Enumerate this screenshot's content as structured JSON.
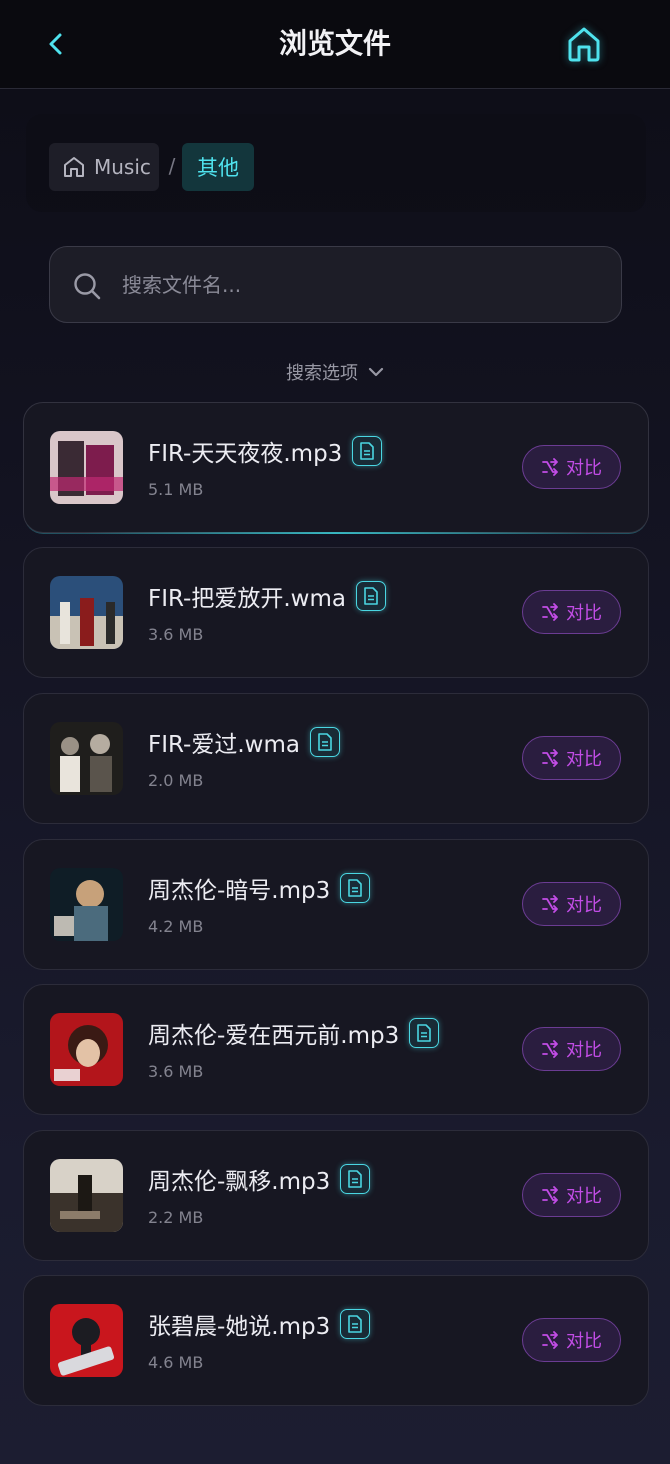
{
  "header": {
    "title": "浏览文件"
  },
  "breadcrumb": {
    "root": "Music",
    "separator": "/",
    "current": "其他"
  },
  "search": {
    "placeholder": "搜索文件名...",
    "value": ""
  },
  "search_options_label": "搜索选项",
  "compare_label": "对比",
  "files": [
    {
      "name": "FIR-天天夜夜.mp3",
      "size": "5.1 MB",
      "cover_colors": [
        "#d9c6c9",
        "#7d1c4d",
        "#3a2a34"
      ]
    },
    {
      "name": "FIR-把爱放开.wma",
      "size": "3.6 MB",
      "cover_colors": [
        "#2b4f7a",
        "#c9c2b5",
        "#8a1c1c"
      ]
    },
    {
      "name": "FIR-爱过.wma",
      "size": "2.0 MB",
      "cover_colors": [
        "#1f1e1c",
        "#9a9186",
        "#e9e4dc"
      ]
    },
    {
      "name": "周杰伦-暗号.mp3",
      "size": "4.2 MB",
      "cover_colors": [
        "#0f1d26",
        "#c7a17a",
        "#4b6b7d"
      ]
    },
    {
      "name": "周杰伦-爱在西元前.mp3",
      "size": "3.6 MB",
      "cover_colors": [
        "#b3151b",
        "#3a1a14",
        "#e3c2a6"
      ]
    },
    {
      "name": "周杰伦-飘移.mp3",
      "size": "2.2 MB",
      "cover_colors": [
        "#d8d2c8",
        "#3a322b",
        "#8c7c6a"
      ]
    },
    {
      "name": "张碧晨-她说.mp3",
      "size": "4.6 MB",
      "cover_colors": [
        "#c9161d",
        "#1c1c22",
        "#d9d9dd"
      ]
    }
  ],
  "colors": {
    "accent_cyan": "#4fe3ee",
    "compare_purple": "#c24de6",
    "card_bg": "#171722"
  }
}
